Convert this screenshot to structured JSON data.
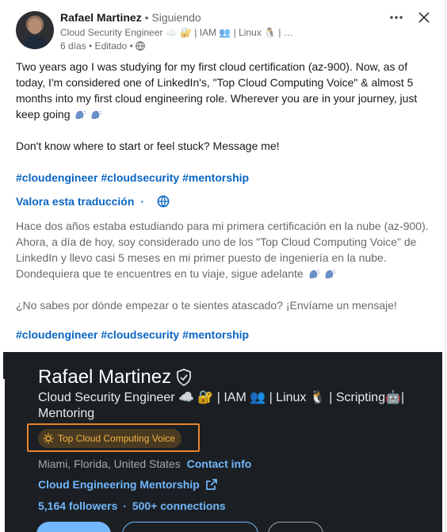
{
  "author": {
    "name": "Rafael Martinez",
    "following": "• Siguiendo",
    "headline": "Cloud Security Engineer ☁️ 🔐 | IAM 👥 | Linux 🐧 | …",
    "meta": "6 días • Editado •"
  },
  "post": {
    "p1": "Two years ago I was studying for my first cloud certification (az-900). Now, as of today, I'm considered one of LinkedIn's, \"Top Cloud Computing Voice\" & almost 5 months into my first cloud engineering role. Wherever you are in your journey, just keep going",
    "p2": "Don't know where to start or feel stuck? Message me!",
    "hashtags": [
      "#cloudengineer",
      "#cloudsecurity",
      "#mentorship"
    ]
  },
  "translation": {
    "label": "Valora esta traducción",
    "dot": "·",
    "p1": "Hace dos años estaba estudiando para mi primera certificación en la nube (az-900). Ahora, a día de hoy, soy considerado uno de los \"Top Cloud Computing Voice\" de LinkedIn y llevo casi 5 meses en mi primer puesto de ingeniería en la nube. Dondequiera que te encuentres en tu viaje, sigue adelante",
    "p2": "¿No sabes por dónde empezar o te sientes atascado? ¡Envíame un mensaje!",
    "hashtags": [
      "#cloudengineer",
      "#cloudsecurity",
      "#mentorship"
    ]
  },
  "profile_image": {
    "name": "Rafael Martinez",
    "headline": "Cloud Security Engineer ☁️ 🔐 | IAM 👥 | Linux 🐧 | Scripting🤖| Mentoring",
    "badge": "Top Cloud Computing Voice",
    "location": "Miami, Florida, United States",
    "contact": "Contact info",
    "link": "Cloud Engineering Mentorship",
    "followers": "5,164 followers",
    "connections": "500+ connections"
  },
  "colors": {
    "link_blue": "#0a66c2",
    "dark_bg": "#1b1f23",
    "badge_gold": "#f2b33f",
    "badge_outline": "#e8842c"
  },
  "icons": [
    "more-icon",
    "close-icon",
    "globe-icon",
    "verified-shield-icon",
    "sun-badge-icon",
    "external-link-icon",
    "speaking-head-icon"
  ]
}
